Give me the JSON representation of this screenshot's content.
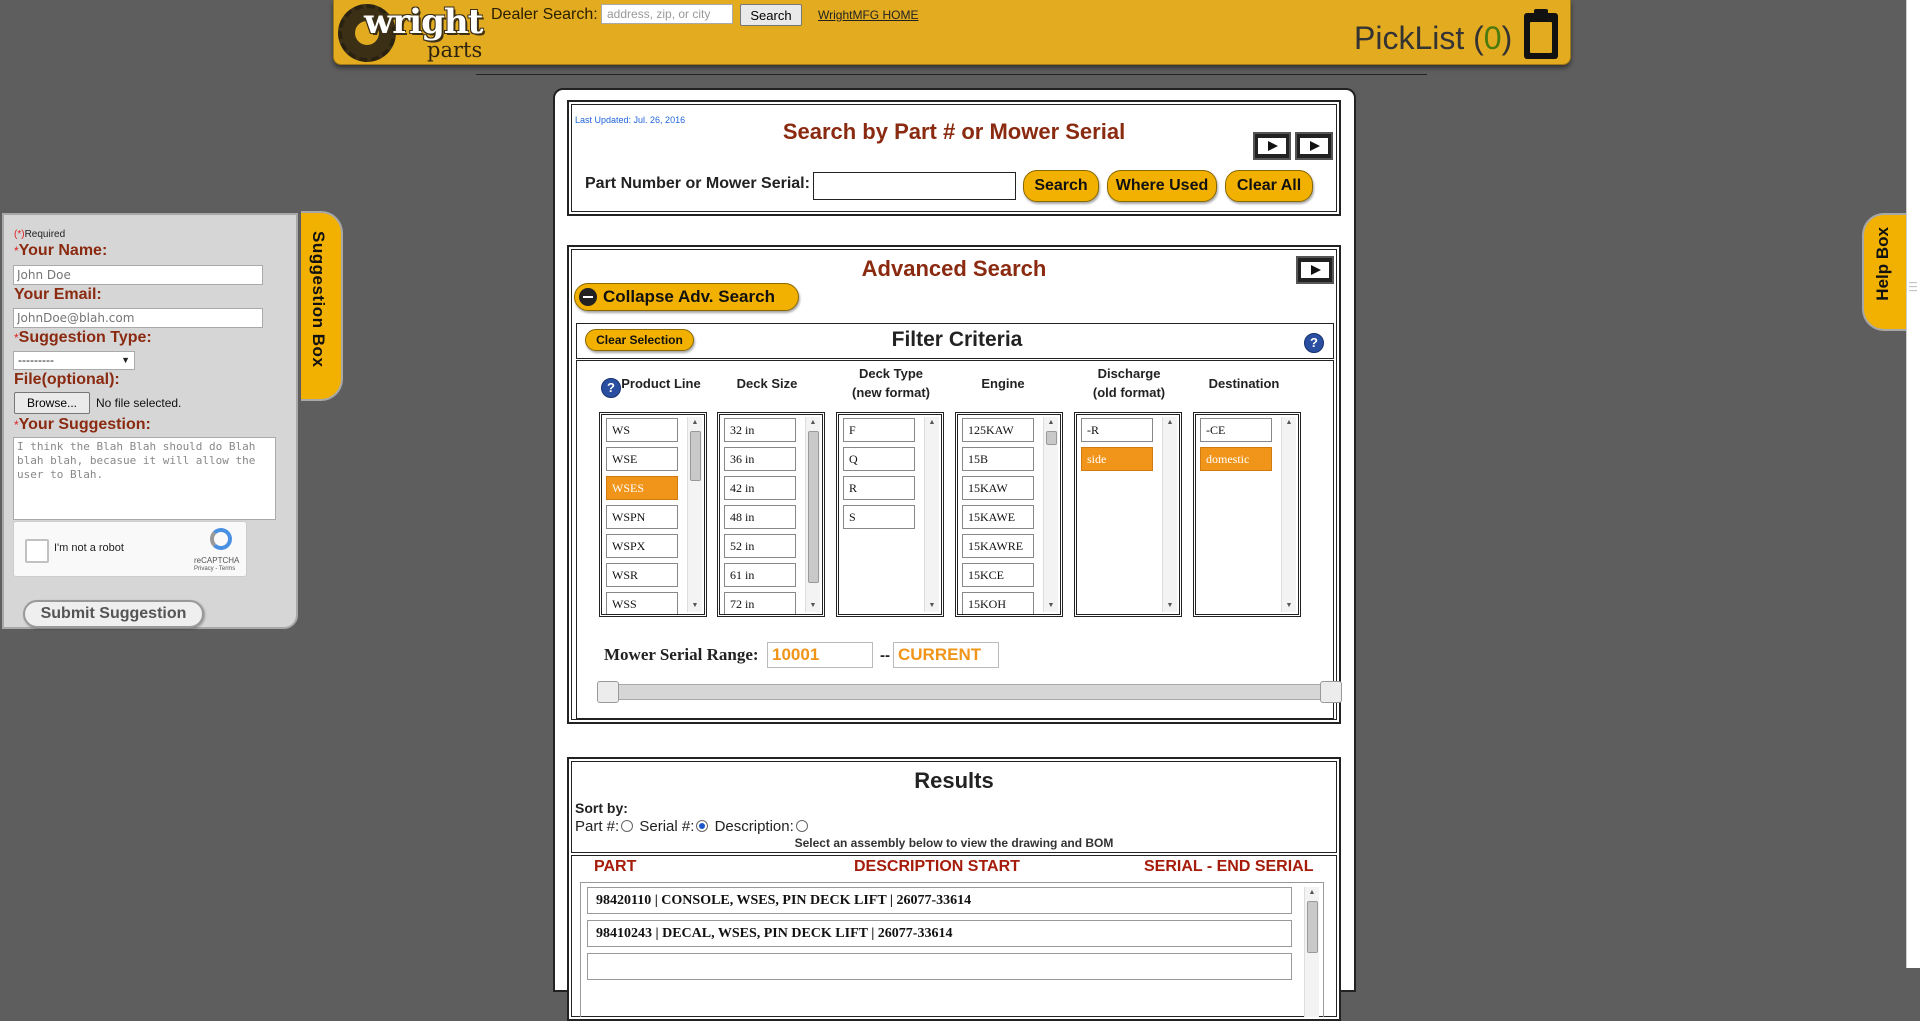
{
  "header": {
    "logo_word": "wright",
    "logo_sub": "parts",
    "dealer_label": "Dealer Search:",
    "dealer_placeholder": "address, zip, or city",
    "search_button": "Search",
    "home_link": "WrightMFG HOME",
    "picklist_label": "PickList (",
    "picklist_count": "0",
    "picklist_close": ")"
  },
  "search_panel": {
    "last_updated": "Last Updated: Jul. 26, 2016",
    "title": "Search by Part # or Mower Serial",
    "input_label": "Part Number or Mower Serial:",
    "input_value": "",
    "search_button": "Search",
    "where_used_button": "Where Used",
    "clear_all_button": "Clear All"
  },
  "advanced": {
    "title": "Advanced Search",
    "collapse_button": "Collapse Adv. Search",
    "clear_selection_button": "Clear Selection",
    "filter_title": "Filter Criteria",
    "columns": [
      {
        "header": "Product Line",
        "items": [
          "WS",
          "WSE",
          "WSES",
          "WSPN",
          "WSPX",
          "WSR",
          "WSS"
        ],
        "selected": "WSES"
      },
      {
        "header": "Deck Size",
        "items": [
          "32 in",
          "36 in",
          "42 in",
          "48 in",
          "52 in",
          "61 in",
          "72 in"
        ],
        "selected": ""
      },
      {
        "header": "Deck Type\n(new format)",
        "header_line1": "Deck Type",
        "header_line2": "(new format)",
        "items": [
          "F",
          "Q",
          "R",
          "S"
        ],
        "selected": ""
      },
      {
        "header": "Engine",
        "items": [
          "125KAW",
          "15B",
          "15KAW",
          "15KAWE",
          "15KAWRE",
          "15KCE",
          "15KOH"
        ],
        "selected": ""
      },
      {
        "header_line1": "Discharge",
        "header_line2": "(old format)",
        "items": [
          "-R",
          "side"
        ],
        "selected": "side"
      },
      {
        "header": "Destination",
        "items": [
          "-CE",
          "domestic"
        ],
        "selected": "domestic"
      }
    ],
    "serial_label": "Mower Serial Range:",
    "serial_start": "10001",
    "serial_separator": "--",
    "serial_end": "CURRENT"
  },
  "results": {
    "title": "Results",
    "sort_by": "Sort by:",
    "sort_part": "Part #:",
    "sort_serial": "Serial #:",
    "sort_description": "Description:",
    "sort_selected": "serial",
    "instruction": "Select an assembly below to view the drawing and BOM",
    "col_part": "PART",
    "col_description": "DESCRIPTION START",
    "col_serial": "SERIAL - END SERIAL",
    "rows": [
      "98420110 | CONSOLE, WSES, PIN DECK LIFT | 26077-33614",
      "98410243 | DECAL, WSES, PIN DECK LIFT | 26077-33614",
      ""
    ]
  },
  "suggestion_box": {
    "tab_label": "Suggestion Box",
    "required_note": "Required",
    "required_mark": "(*)",
    "name_label": "Your Name:",
    "name_placeholder": "John Doe",
    "email_label": "Your Email:",
    "email_placeholder": "JohnDoe@blah.com",
    "type_label": "Suggestion Type:",
    "type_value": "---------",
    "file_label": "File(optional):",
    "browse_button": "Browse...",
    "file_status": "No file selected.",
    "suggestion_label": "Your Suggestion:",
    "suggestion_placeholder": "I think the Blah Blah should do Blah blah blah, becasue it will allow the user to Blah.",
    "captcha_label": "I'm not a robot",
    "captcha_brand": "reCAPTCHA",
    "captcha_links": "Privacy - Terms",
    "submit_button": "Submit Suggestion"
  },
  "help_box": {
    "tab_label": "Help Box"
  },
  "colors": {
    "brand_gold": "#e3ab20",
    "pill_gold": "#f2b100",
    "selected_orange": "#f0951a",
    "title_maroon": "#8a2a10",
    "results_header_red": "#a51c0a",
    "background": "#5e5e5e"
  },
  "icons": [
    "gear-logo-icon",
    "clipboard-icon",
    "video-play-icon",
    "help-question-icon",
    "minus-circle-icon",
    "recaptcha-icon"
  ]
}
